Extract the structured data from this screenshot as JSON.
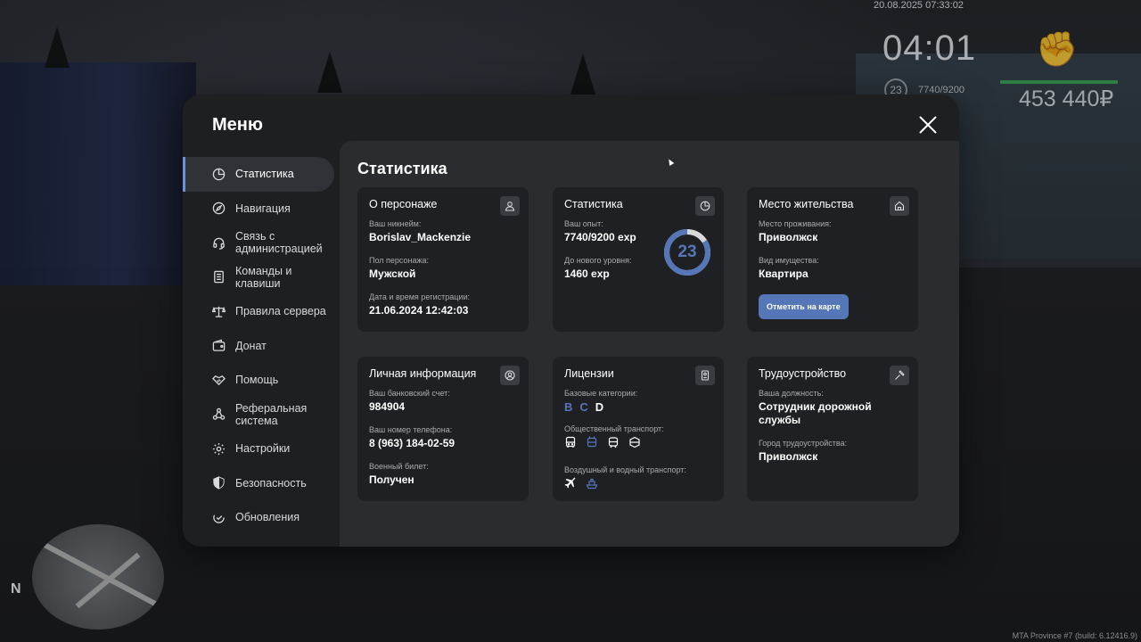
{
  "hud": {
    "datetime": "20.08.2025 07:33:02",
    "clock": "04:01",
    "level": "23",
    "exp": "7740/9200",
    "money": "453 440₽",
    "build": "MTA Province #7 (build: 6.12416.9)",
    "minimap_north": "N"
  },
  "menu": {
    "title": "Меню",
    "nav": [
      {
        "label": "Статистика",
        "icon": "pie-chart-icon",
        "active": true
      },
      {
        "label": "Навигация",
        "icon": "compass-icon"
      },
      {
        "label": "Связь с администрацией",
        "icon": "headset-icon"
      },
      {
        "label": "Команды и клавиши",
        "icon": "document-icon"
      },
      {
        "label": "Правила сервера",
        "icon": "scales-icon"
      },
      {
        "label": "Донат",
        "icon": "wallet-icon"
      },
      {
        "label": "Помощь",
        "icon": "handshake-icon"
      },
      {
        "label": "Реферальная система",
        "icon": "network-icon"
      },
      {
        "label": "Настройки",
        "icon": "gear-icon"
      },
      {
        "label": "Безопасность",
        "icon": "shield-icon"
      },
      {
        "label": "Обновления",
        "icon": "check-circle-icon"
      }
    ]
  },
  "content": {
    "title": "Статистика",
    "character": {
      "title": "О персонаже",
      "nickname_label": "Ваш никнейм:",
      "nickname": "Borislav_Mackenzie",
      "gender_label": "Пол персонажа:",
      "gender": "Мужской",
      "reg_label": "Дата и время регистрации:",
      "reg": "21.06.2024 12:42:03"
    },
    "stats": {
      "title": "Статистика",
      "exp_label": "Ваш опыт:",
      "exp": "7740/9200 exp",
      "next_label": "До нового уровня:",
      "next": "1460 exp",
      "level": "23",
      "progress": 0.841
    },
    "residence": {
      "title": "Место жительства",
      "place_label": "Место проживания:",
      "place": "Приволжск",
      "type_label": "Вид имущества:",
      "type": "Квартира",
      "map_button": "Отметить на карте"
    },
    "personal": {
      "title": "Личная информация",
      "bank_label": "Ваш банковский счет:",
      "bank": "984904",
      "phone_label": "Ваш номер телефона:",
      "phone": "8 (963) 184-02-59",
      "military_label": "Военный билет:",
      "military": "Получен"
    },
    "licenses": {
      "title": "Лицензии",
      "base_label": "Базовые категории:",
      "categories": [
        {
          "label": "B",
          "color": "#5577b8"
        },
        {
          "label": "C",
          "color": "#5577b8"
        },
        {
          "label": "D",
          "color": "#ffffff"
        }
      ],
      "public_label": "Общественный транспорт:",
      "air_label": "Воздушный и водный транспорт:"
    },
    "job": {
      "title": "Трудоустройство",
      "position_label": "Ваша должность:",
      "position": "Сотрудник дорожной службы",
      "city_label": "Город трудоустройства:",
      "city": "Приволжск"
    }
  },
  "colors": {
    "accent": "#5577b8",
    "active_bar": "#6f8fd6",
    "hud_bar": "#2e8b47"
  }
}
